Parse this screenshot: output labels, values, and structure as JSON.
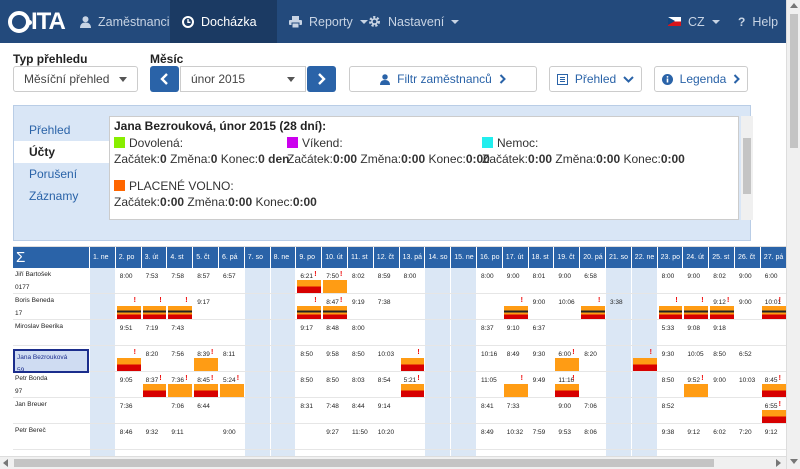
{
  "nav": {
    "brand": "ITA",
    "items": [
      {
        "label": "Zaměstnanci",
        "icon": "user-icon"
      },
      {
        "label": "Docházka",
        "icon": "clock-icon",
        "active": true
      },
      {
        "label": "Reporty",
        "icon": "print-icon"
      },
      {
        "label": "Nastavení",
        "icon": "gear-icon"
      }
    ],
    "language": "CZ",
    "help": "Help"
  },
  "filters": {
    "type_label": "Typ přehledu",
    "type_value": "Měsíční přehled",
    "month_label": "Měsíc",
    "month_value": "únor 2015",
    "employee_filter": "Filtr zaměstnanců",
    "overview": "Přehled",
    "legend": "Legenda"
  },
  "side_tabs": [
    "Přehled",
    "Účty",
    "Porušení",
    "Záznamy"
  ],
  "info": {
    "title": "Jana Bezrouková, únor 2015 (28 dní):",
    "start": "Začátek:",
    "change": "Změna:",
    "end": "Konec:",
    "accounts": [
      {
        "name": "Dovolená:",
        "color": "#88ee00",
        "start": "0",
        "change": "0",
        "end": "0 den"
      },
      {
        "name": "Víkend:",
        "color": "#cc00ee",
        "start": "0:00",
        "change": "0:00",
        "end": "0:00"
      },
      {
        "name": "Nemoc:",
        "color": "#22eeee",
        "start": "0:00",
        "change": "0:00",
        "end": "0:00"
      },
      {
        "name": "PLACENÉ VOLNO:",
        "color": "#ff6600",
        "start": "0:00",
        "change": "0:00",
        "end": "0:00"
      }
    ]
  },
  "grid": {
    "sigma": "Σ",
    "days": [
      "1. ne",
      "2. po",
      "3. út",
      "4. st",
      "5. čt",
      "6. pá",
      "7. so",
      "8. ne",
      "9. po",
      "10. út",
      "11. st",
      "12. čt",
      "13. pá",
      "14. so",
      "15. ne",
      "16. po",
      "17. út",
      "18. st",
      "19. čt",
      "20. pá",
      "21. so",
      "22. ne",
      "23. po",
      "24. út",
      "25. st",
      "26. čt",
      "27. pá"
    ],
    "weekend_days": [
      0,
      6,
      7,
      13,
      14,
      20,
      21
    ],
    "rows": [
      {
        "name": "Jiří Bartošek",
        "sub": "0177",
        "cells": {
          "1": "8:00",
          "2": "7:53",
          "3": "7:58",
          "4": "8:57",
          "5": "6:57",
          "8": "6:21",
          "9": "7:50",
          "10": "8:02",
          "11": "8:59",
          "12": "8:00",
          "15": "8:00",
          "16": "9:00",
          "17": "8:01",
          "18": "9:00",
          "19": "6:58",
          "22": "8:00",
          "23": "9:00",
          "24": "8:02",
          "25": "9:00",
          "26": "6:00"
        },
        "flags": [
          8,
          9
        ]
      },
      {
        "name": "Boris Beneda",
        "sub": "17",
        "cells": {
          "4": "9:17",
          "9": "8:47",
          "10": "9:19",
          "11": "7:38",
          "17": "9:00",
          "18": "10:06",
          "20": "3:38",
          "24": "9:12",
          "25": "9:00",
          "26": "10:01"
        },
        "flags": [
          1,
          2,
          3,
          8,
          9,
          16,
          19,
          22,
          23,
          24,
          26
        ]
      },
      {
        "name": "Miroslav Beerika",
        "sub": "",
        "cells": {
          "1": "9:51",
          "2": "7:19",
          "3": "7:43",
          "8": "9:17",
          "9": "8:48",
          "10": "8:00",
          "15": "8:37",
          "16": "9:10",
          "17": "6:37",
          "22": "5:33",
          "23": "9:08",
          "24": "9:18"
        },
        "flags": []
      },
      {
        "name": "Jana Bezrouková",
        "sub": "59",
        "cells": {
          "2": "8:20",
          "3": "7:56",
          "4": "8:39",
          "5": "8:11",
          "8": "8:50",
          "9": "9:58",
          "10": "8:50",
          "11": "10:03",
          "15": "10:16",
          "16": "8:49",
          "17": "9:30",
          "18": "6:00",
          "19": "8:20",
          "22": "9:30",
          "23": "10:05",
          "24": "8:50",
          "25": "6:52"
        },
        "flags": [
          1,
          4,
          12,
          18,
          21
        ]
      },
      {
        "name": "Petr Bonda",
        "sub": "97",
        "cells": {
          "1": "9:05",
          "2": "8:37",
          "3": "7:36",
          "4": "8:45",
          "5": "5:24",
          "8": "8:50",
          "9": "8:50",
          "10": "8:03",
          "11": "8:54",
          "12": "5:21",
          "15": "11:05",
          "17": "9:49",
          "18": "11:16",
          "22": "8:50",
          "23": "9:52",
          "24": "9:00",
          "25": "10:03",
          "26": "8:45"
        },
        "flags": [
          2,
          3,
          4,
          5,
          12,
          16,
          18,
          23,
          26
        ]
      },
      {
        "name": "Jan Breuer",
        "sub": "",
        "cells": {
          "1": "7:36",
          "3": "7:06",
          "4": "6:44",
          "8": "8:31",
          "9": "7:48",
          "10": "8:44",
          "11": "9:14",
          "15": "8:41",
          "16": "7:33",
          "18": "9:00",
          "19": "7:06",
          "22": "8:52",
          "26": "6:55"
        },
        "flags": [
          26
        ]
      },
      {
        "name": "Petr Bereč",
        "sub": "",
        "cells": {
          "1": "8:46",
          "2": "9:32",
          "3": "9:11",
          "5": "9:00",
          "9": "9:27",
          "10": "11:50",
          "11": "10:20",
          "15": "8:49",
          "16": "10:32",
          "17": "7:59",
          "18": "9:53",
          "19": "8:06",
          "22": "9:38",
          "23": "9:12",
          "24": "6:02",
          "25": "7:20",
          "26": "9:12"
        },
        "flags": []
      }
    ]
  }
}
